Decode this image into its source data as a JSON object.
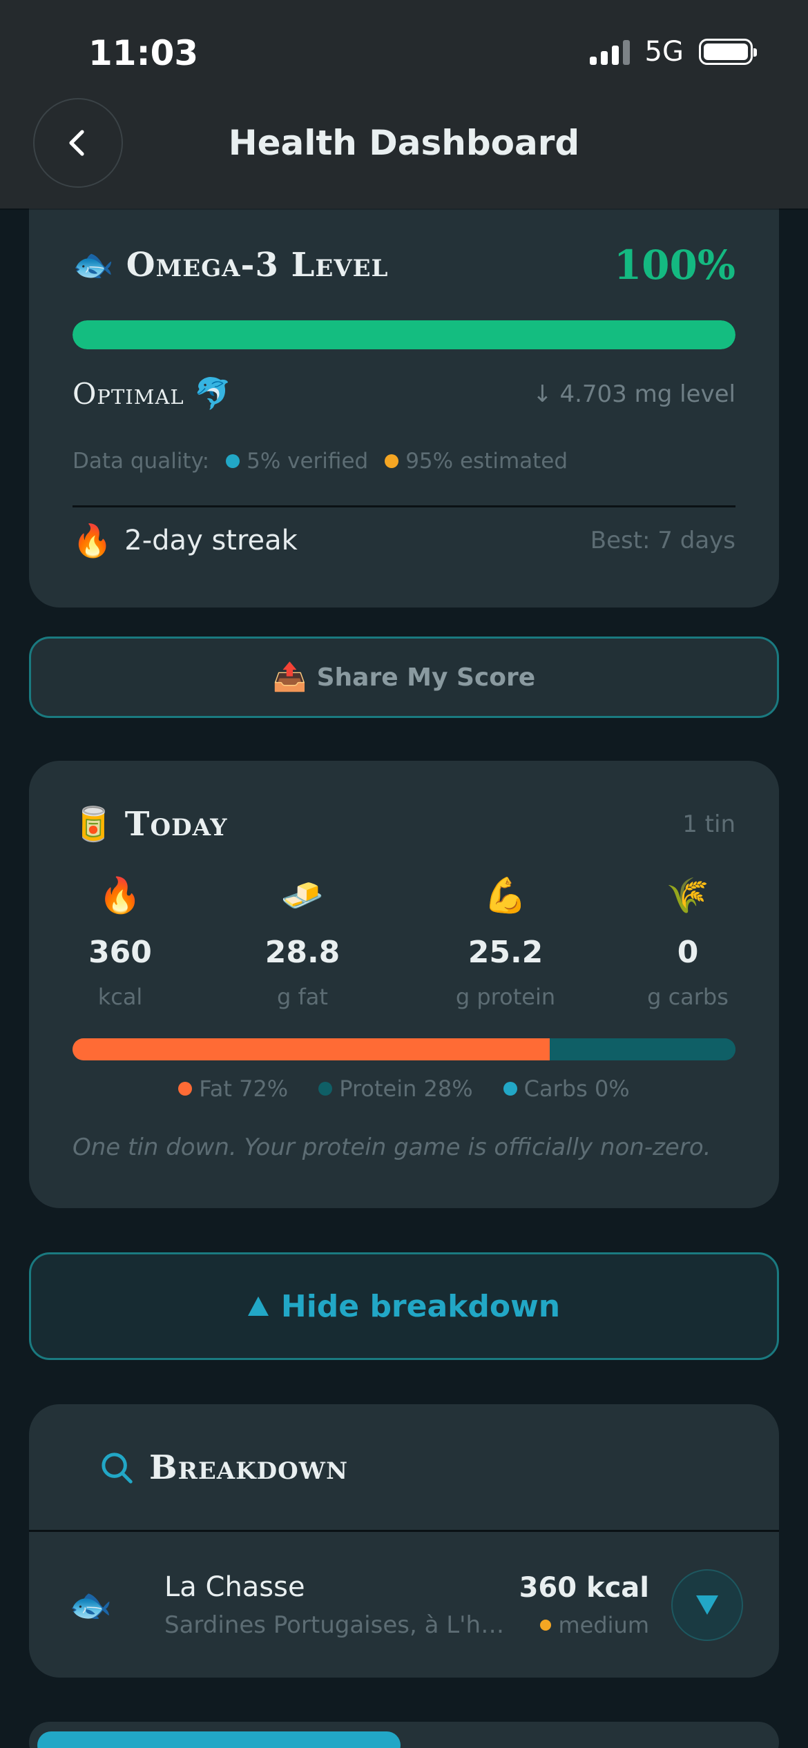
{
  "status_bar": {
    "time": "11:03",
    "network": "5G"
  },
  "header": {
    "title": "Health Dashboard"
  },
  "omega": {
    "title": "Omega-3 Level",
    "percent_label": "100%",
    "percent_value": 100,
    "status": "Optimal",
    "level_text": "↓ 4.703 mg level",
    "quality_label": "Data quality:",
    "verified": "5% verified",
    "estimated": "95% estimated",
    "streak": "2-day streak",
    "best": "Best: 7 days"
  },
  "share_button": "Share My Score",
  "today": {
    "title": "Today",
    "count": "1 tin",
    "macros": [
      {
        "icon": "fire-icon",
        "emoji": "🔥",
        "value": "360",
        "unit": "kcal"
      },
      {
        "icon": "butter-icon",
        "emoji": "🧈",
        "value": "28.8",
        "unit": "g fat"
      },
      {
        "icon": "flexed-biceps-icon",
        "emoji": "💪",
        "value": "25.2",
        "unit": "g protein"
      },
      {
        "icon": "rice-icon",
        "emoji": "🌾",
        "value": "0",
        "unit": "g carbs"
      }
    ],
    "ratio": {
      "fat": 72,
      "protein": 28,
      "carbs": 0
    },
    "legend": {
      "fat": "Fat 72%",
      "protein": "Protein 28%",
      "carbs": "Carbs 0%"
    },
    "quip": "One tin down. Your protein game is officially non-zero."
  },
  "hide_button": "Hide breakdown",
  "breakdown": {
    "title": "Breakdown",
    "items": [
      {
        "brand": "La Chasse",
        "description": "Sardines Portugaises, à L'huil...",
        "kcal": "360 kcal",
        "confidence": "medium"
      }
    ]
  },
  "colors": {
    "accent_green": "#14b981",
    "accent_teal": "#22a7c6",
    "fat": "#ff6b35",
    "protein": "#0f5f66",
    "carbs": "#22a7c6",
    "verified_dot": "#22a7c6",
    "estimated_dot": "#f5a623"
  }
}
